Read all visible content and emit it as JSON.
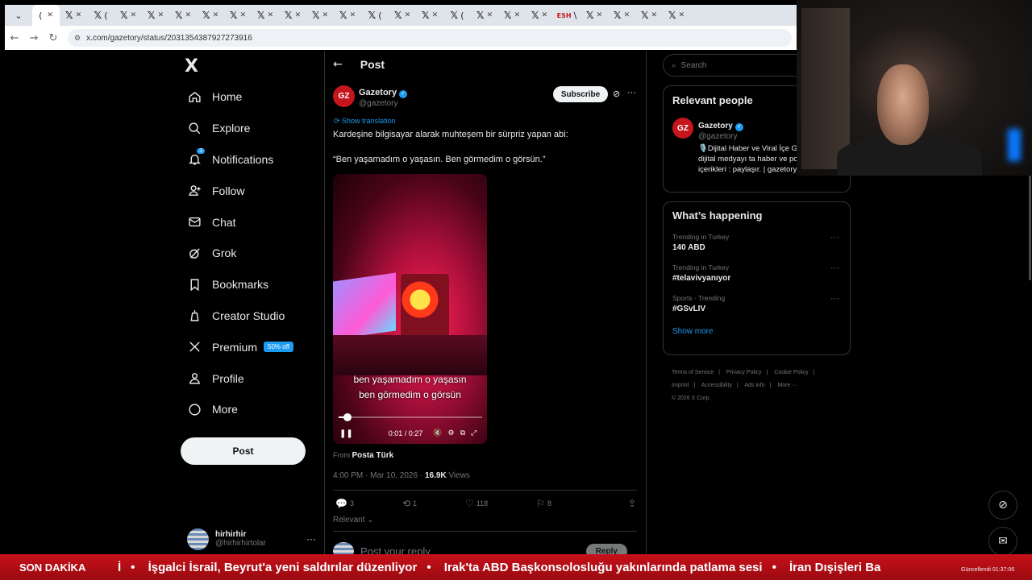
{
  "browser": {
    "url": "x.com/gazetory/status/2031354387927273916",
    "tabs": [
      "(",
      "(",
      "(",
      "",
      "",
      "",
      "",
      "",
      "",
      "",
      "",
      "(",
      "(",
      "",
      "",
      "(",
      "",
      "",
      "",
      "\\",
      "",
      "",
      "",
      ""
    ]
  },
  "sidebar": {
    "logo": "X",
    "items": [
      {
        "label": "Home",
        "icon": "home-icon"
      },
      {
        "label": "Explore",
        "icon": "search-icon"
      },
      {
        "label": "Notifications",
        "icon": "bell-icon",
        "count": "3"
      },
      {
        "label": "Follow",
        "icon": "follow-icon"
      },
      {
        "label": "Chat",
        "icon": "mail-icon"
      },
      {
        "label": "Grok",
        "icon": "grok-icon"
      },
      {
        "label": "Bookmarks",
        "icon": "bookmark-icon"
      },
      {
        "label": "Creator Studio",
        "icon": "creator-icon"
      },
      {
        "label": "Premium",
        "icon": "x-icon",
        "badge": "50% off"
      },
      {
        "label": "Profile",
        "icon": "person-icon"
      },
      {
        "label": "More",
        "icon": "more-circle-icon"
      }
    ],
    "post_button": "Post",
    "user": {
      "name": "hirhirhir",
      "handle": "@hirhirhirtolar",
      "more": "···"
    }
  },
  "main": {
    "title": "Post",
    "back": "←",
    "author": {
      "logo": "GZ",
      "name": "Gazetory",
      "handle": "@gazetory"
    },
    "subscribe": "Subscribe",
    "more": "···",
    "show_translation": "Show translation",
    "text": "Kardeşine bilgisayar alarak muhteşem bir sürpriz yapan abi:",
    "quote": "“Ben yaşamadım o yaşasın. Ben görmedim o görsün.”",
    "video": {
      "caption_line1": "ben yaşamadım o yaşasın",
      "caption_line2": "ben görmedim o görsün",
      "time": "0:01 / 0:27",
      "progress": 0.04
    },
    "from_label": "From",
    "from_source": "Posta Türk",
    "timestamp": "4:00 PM · Mar 10, 2026 · ",
    "views_count": "16.9K",
    "views_label": "Views",
    "actions": {
      "replies": "3",
      "reposts": "1",
      "likes": "118",
      "bookmarks": "8"
    },
    "relevant": "Relevant",
    "reply_placeholder": "Post your reply",
    "reply_button": "Reply"
  },
  "right": {
    "search_placeholder": "Search",
    "relevant_people": {
      "title": "Relevant people",
      "name": "Gazetory",
      "handle": "@gazetory",
      "bio": "🎙️Dijital Haber ve Viral İçe Gazetory dijital medyayı ta haber ve popüler içerikleri : paylaşır. | gazetory@gmail.com"
    },
    "whats_happening": {
      "title": "What’s happening",
      "trends": [
        {
          "context": "Trending in Turkey",
          "name": "140 ABD"
        },
        {
          "context": "Trending in Turkey",
          "name": "#telavivyanıyor"
        },
        {
          "context": "Sports · Trending",
          "name": "#GSvLIV"
        }
      ],
      "show_more": "Show more"
    },
    "footer": [
      "Terms of Service",
      "|",
      "Privacy Policy",
      "|",
      "Cookie Policy",
      "|",
      "Imprint",
      "|",
      "Accessibility",
      "|",
      "Ads info",
      "|",
      "More ···",
      "© 2026 X Corp."
    ]
  },
  "ticker": {
    "label": "SON DAKİKA",
    "items": [
      "İ",
      "İşgalci İsrail, Beyrut'a yeni saldırılar düzenliyor",
      "Irak'ta ABD Başkonsolosluğu yakınlarında patlama sesi",
      "İran Dışişleri Ba"
    ],
    "clock": "Güncellendi 01:37:06"
  },
  "colors": {
    "accent": "#1d9bf0",
    "ticker": "#c7101a",
    "background": "#000000"
  }
}
